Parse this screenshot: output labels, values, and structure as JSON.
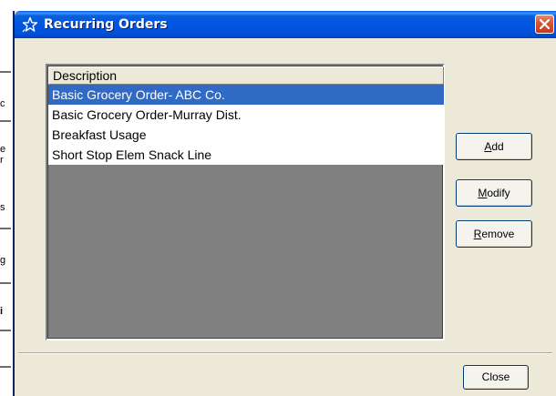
{
  "window": {
    "title": "Recurring Orders",
    "title_icon": "star-icon"
  },
  "list": {
    "header": "Description",
    "items": [
      {
        "label": "Basic Grocery Order- ABC Co.",
        "selected": true
      },
      {
        "label": "Basic Grocery Order-Murray Dist.",
        "selected": false
      },
      {
        "label": "Breakfast Usage",
        "selected": false
      },
      {
        "label": "Short Stop Elem Snack Line",
        "selected": false
      }
    ]
  },
  "buttons": {
    "add_mnemonic": "A",
    "add_rest": "dd",
    "modify_mnemonic": "M",
    "modify_rest": "odify",
    "remove_mnemonic": "R",
    "remove_rest": "emove",
    "close": "Close"
  },
  "background_fragments": [
    "c",
    "e",
    "r",
    "s",
    "g",
    "i"
  ],
  "colors": {
    "title_bar": "#0054e3",
    "selection": "#316ac5",
    "list_empty_area": "#808080",
    "dialog_face": "#ece9d8",
    "close_button": "#d9522c"
  }
}
